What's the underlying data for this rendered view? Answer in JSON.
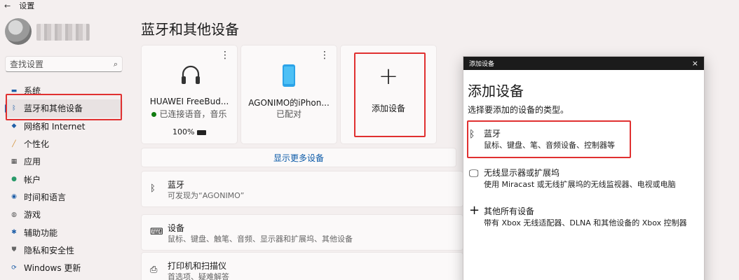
{
  "window": {
    "back_glyph": "←",
    "title": "设置"
  },
  "search": {
    "placeholder": "查找设置",
    "icon": "search-icon"
  },
  "sidebar": {
    "items": [
      {
        "label": "系统",
        "icon": "display-icon"
      },
      {
        "label": "蓝牙和其他设备",
        "icon": "bluetooth-icon",
        "selected": true
      },
      {
        "label": "网络和 Internet",
        "icon": "wifi-icon"
      },
      {
        "label": "个性化",
        "icon": "brush-icon"
      },
      {
        "label": "应用",
        "icon": "apps-icon"
      },
      {
        "label": "帐户",
        "icon": "person-icon"
      },
      {
        "label": "时间和语言",
        "icon": "globe-icon"
      },
      {
        "label": "游戏",
        "icon": "gamepad-icon"
      },
      {
        "label": "辅助功能",
        "icon": "accessibility-icon"
      },
      {
        "label": "隐私和安全性",
        "icon": "shield-icon"
      },
      {
        "label": "Windows 更新",
        "icon": "update-icon"
      }
    ]
  },
  "main": {
    "title": "蓝牙和其他设备",
    "devices": [
      {
        "name": "HUAWEI FreeBud...",
        "status": "已连接语音，音乐",
        "battery": "100%",
        "icon": "headphones-icon",
        "connected": true
      },
      {
        "name": "AGONIMO的iPhon...",
        "status": "已配对",
        "icon": "phone-icon"
      }
    ],
    "add_device": {
      "label": "添加设备",
      "icon": "plus-icon"
    },
    "show_more": "显示更多设备",
    "rows": [
      {
        "title": "蓝牙",
        "sub": "可发现为“AGONIMO”",
        "icon": "bluetooth-icon"
      },
      {
        "title": "设备",
        "sub": "鼠标、键盘、触笔、音频、显示器和扩展坞、其他设备",
        "icon": "keyboard-icon"
      },
      {
        "title": "打印机和扫描仪",
        "sub": "首选项、疑难解答",
        "icon": "printer-icon"
      }
    ]
  },
  "dialog": {
    "bar_title": "添加设备",
    "close": "×",
    "title": "添加设备",
    "subtitle": "选择要添加的设备的类型。",
    "options": [
      {
        "title": "蓝牙",
        "sub": "鼠标、键盘、笔、音频设备、控制器等",
        "icon": "bluetooth-icon"
      },
      {
        "title": "无线显示器或扩展坞",
        "sub": "使用 Miracast 或无线扩展坞的无线监视器、电视或电脑",
        "icon": "monitor-icon"
      },
      {
        "title": "其他所有设备",
        "sub": "带有 Xbox 无线适配器、DLNA 和其他设备的 Xbox 控制器",
        "icon": "plus-icon"
      }
    ]
  },
  "colors": {
    "accent": "#0067c0",
    "highlight": "#e03030",
    "connected": "#107c10"
  }
}
